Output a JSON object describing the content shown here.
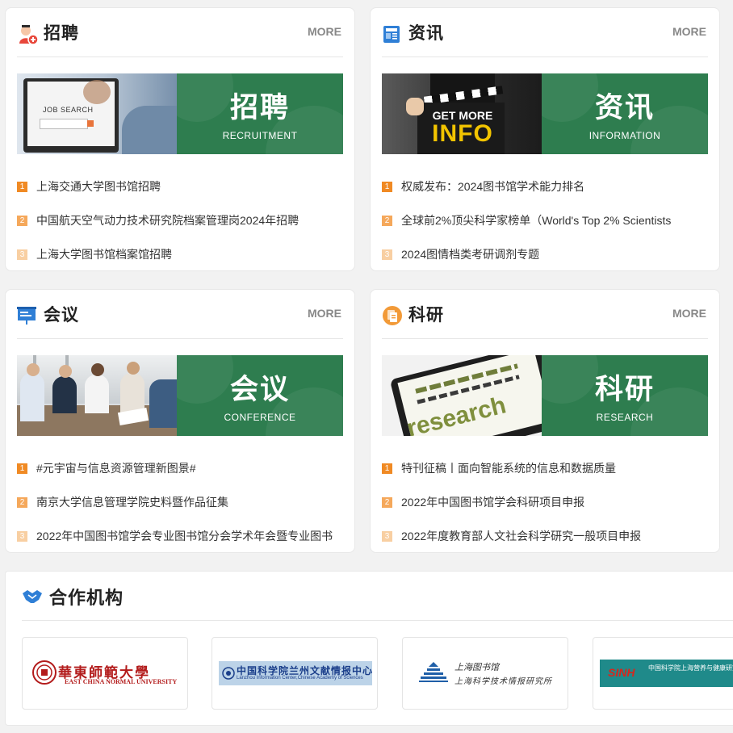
{
  "more_label": "MORE",
  "sections": [
    {
      "title": "招聘",
      "icon": "recruiter-icon",
      "banner_cn": "招聘",
      "banner_en": "RECRUITMENT",
      "photo_text": "JOB SEARCH",
      "items": [
        "上海交通大学图书馆招聘",
        "中国航天空气动力技术研究院档案管理岗2024年招聘",
        "上海大学图书馆档案馆招聘"
      ]
    },
    {
      "title": "资讯",
      "icon": "news-icon",
      "banner_cn": "资讯",
      "banner_en": "INFORMATION",
      "photo_text_1": "GET MORE",
      "photo_text_2": "INFO",
      "items": [
        "权威发布：2024图书馆学术能力排名",
        "全球前2%顶尖科学家榜单（World's Top 2% Scientists",
        "2024图情档类考研调剂专题"
      ]
    },
    {
      "title": "会议",
      "icon": "presentation-board-icon",
      "banner_cn": "会议",
      "banner_en": "CONFERENCE",
      "items": [
        "#元宇宙与信息资源管理新图景#",
        "南京大学信息管理学院史料暨作品征集",
        "2022年中国图书馆学会专业图书馆分会学术年会暨专业图书"
      ]
    },
    {
      "title": "科研",
      "icon": "documents-icon",
      "banner_cn": "科研",
      "banner_en": "RESEARCH",
      "photo_text": "research",
      "items": [
        "特刊征稿丨面向智能系统的信息和数据质量",
        "2022年中国图书馆学会科研项目申报",
        "2022年度教育部人文社会科学研究一般项目申报"
      ]
    }
  ],
  "partners": {
    "title": "合作机构",
    "logos": [
      {
        "cn": "華東師範大學",
        "en": "EAST CHINA NORMAL UNIVERSITY"
      },
      {
        "cn": "中国科学院兰州文献情报中心",
        "en": "Lanzhou Information Center,Chinese Academy of Sciences"
      },
      {
        "cn1": "上海图书馆",
        "cn2": "上海科学技术情报研究所"
      },
      {
        "abbr": "SINH",
        "cn": "中国科学院上海营养与健康研究所"
      }
    ]
  },
  "colors": {
    "banner_green": "#2e7d4f",
    "rank1": "#f08a24",
    "rank2": "#f5a85b",
    "rank3": "#f8cfa2"
  }
}
